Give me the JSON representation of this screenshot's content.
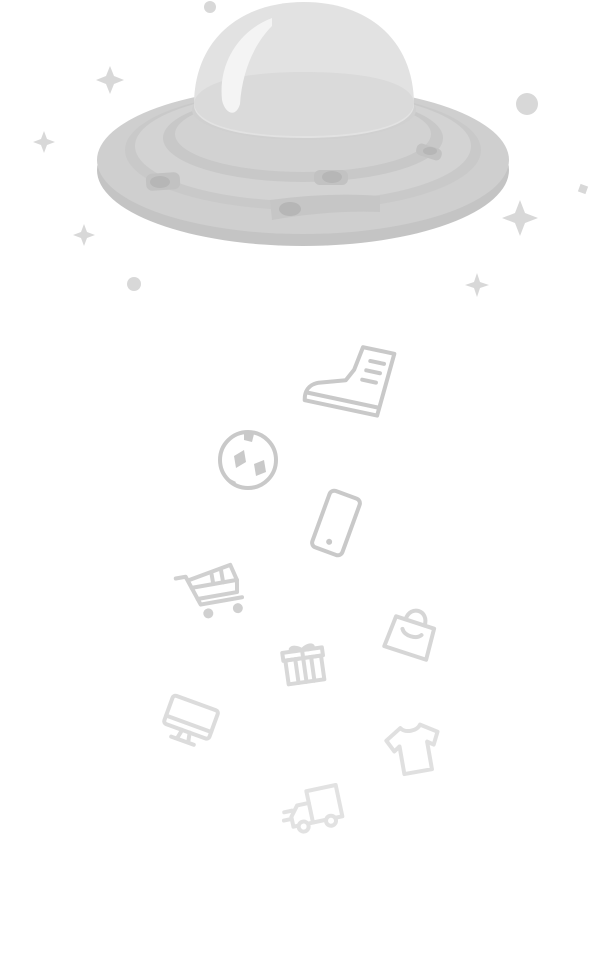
{
  "illustration": {
    "subject": "ufo-abducting-shopping-items",
    "colors": {
      "saucer_rim": "#c8c8c8",
      "saucer_top": "#d4d4d4",
      "saucer_ring": "#cbcbcb",
      "saucer_light": "#bdbdbd",
      "dome": "#e4e4e4",
      "dome_base": "#d6d6d6",
      "dome_highlight": "#f6f6f6",
      "sparkle": "#d8d8d8",
      "item_strong": "#c9c9c9",
      "item_light": "#e2e2e2"
    },
    "items": [
      {
        "icon": "boot-icon"
      },
      {
        "icon": "soccer-ball-icon"
      },
      {
        "icon": "smartphone-icon"
      },
      {
        "icon": "shopping-cart-icon"
      },
      {
        "icon": "shopping-bag-icon"
      },
      {
        "icon": "gift-icon"
      },
      {
        "icon": "monitor-icon"
      },
      {
        "icon": "t-shirt-icon"
      },
      {
        "icon": "delivery-truck-icon"
      }
    ]
  }
}
